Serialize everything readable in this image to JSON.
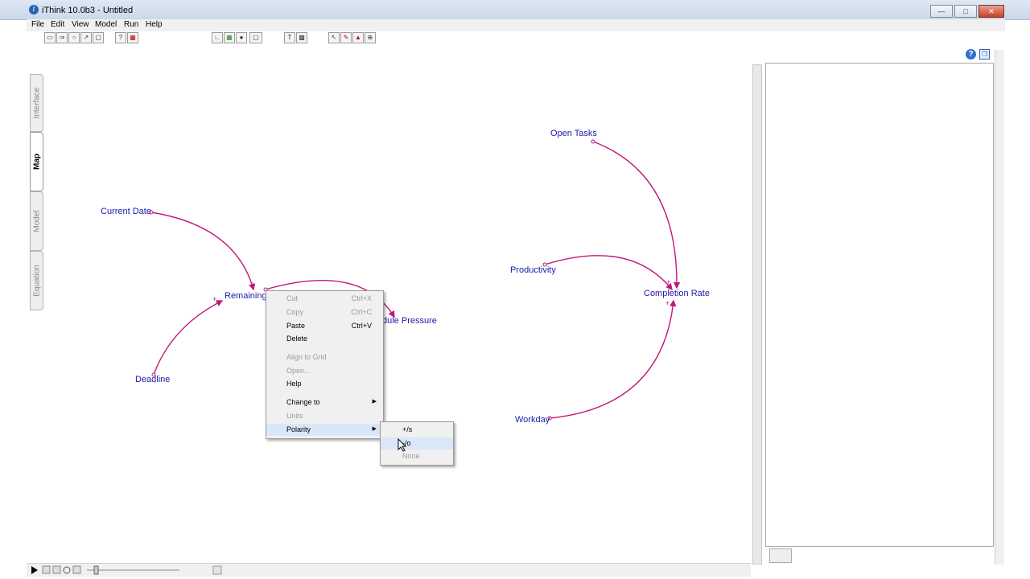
{
  "window": {
    "title": "iThink 10.0b3 - Untitled",
    "app_icon": "i"
  },
  "menu": [
    "File",
    "Edit",
    "View",
    "Model",
    "Run",
    "Help"
  ],
  "side_tabs": [
    "Interface",
    "Map",
    "Model",
    "Equation"
  ],
  "variables": {
    "current_date": "Current Date",
    "remaining": "Remaining",
    "deadline": "Deadline",
    "schedule_pressure": "dule Pressure",
    "open_tasks": "Open Tasks",
    "productivity": "Productivity",
    "completion_rate": "Completion Rate",
    "workday": "Workday"
  },
  "polarity_marks": {
    "minus": "-",
    "plus": "+"
  },
  "context_menu": {
    "items": [
      {
        "label": "Cut",
        "shortcut": "Ctrl+X",
        "enabled": false
      },
      {
        "label": "Copy",
        "shortcut": "Ctrl+C",
        "enabled": false
      },
      {
        "label": "Paste",
        "shortcut": "Ctrl+V",
        "enabled": true
      },
      {
        "label": "Delete",
        "shortcut": "",
        "enabled": true
      },
      {
        "label": "Align to Grid",
        "shortcut": "",
        "enabled": false
      },
      {
        "label": "Open...",
        "shortcut": "",
        "enabled": false
      },
      {
        "label": "Help",
        "shortcut": "",
        "enabled": true
      },
      {
        "label": "Change to",
        "shortcut": "",
        "enabled": true,
        "submenu": true
      },
      {
        "label": "Units",
        "shortcut": "",
        "enabled": false
      },
      {
        "label": "Polarity",
        "shortcut": "",
        "enabled": true,
        "submenu": true
      }
    ]
  },
  "polarity_submenu": {
    "items": [
      {
        "label": "+/s",
        "enabled": true
      },
      {
        "label": "-/o",
        "enabled": true
      },
      {
        "label": "None",
        "enabled": false
      }
    ]
  },
  "toolbar": {
    "text_tool": "T"
  },
  "panel": {
    "help_icon": "?"
  },
  "colors": {
    "link": "#c0187a",
    "variable_text": "#1a1aa8"
  }
}
